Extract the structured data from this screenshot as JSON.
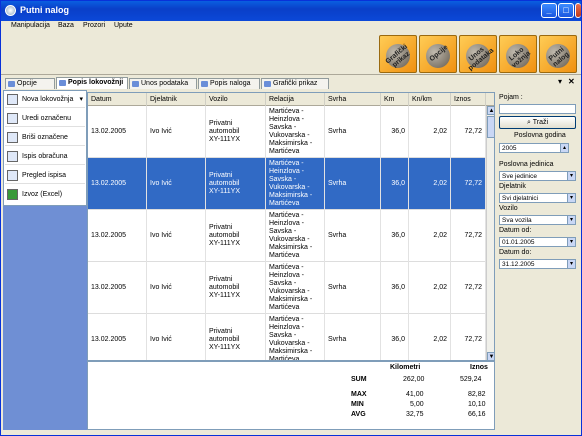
{
  "window": {
    "title": "Putni nalog"
  },
  "menu": [
    "Manipulacija",
    "Baza",
    "Prozori",
    "Upute"
  ],
  "toolbar": [
    "Grafički prikaz",
    "Opcije",
    "Unos podataka",
    "Loko vožnja",
    "Putni nalog"
  ],
  "tabs": [
    "Opcije",
    "Popis lokovožnji",
    "Unos podataka",
    "Popis naloga",
    "Grafički prikaz"
  ],
  "active_tab": 1,
  "sidebar": [
    "Nova lokovožnja",
    "Uredi označenu",
    "Briši označene",
    "Ispis obračuna",
    "Pregled ispisa",
    "Izvoz (Excel)"
  ],
  "columns": [
    "Datum",
    "Djelatnik",
    "Vozilo",
    "Relacija",
    "Svrha",
    "Km",
    "Kn/km",
    "Iznos"
  ],
  "rows": [
    {
      "datum": "13.02.2005",
      "djelatnik": "Ivo Ivić",
      "vozilo": "Privatni\nautomobil\nXY-111YX",
      "relacija": "Martićeva -\nHeinzlova -\nSavska -\nVukovarska -\nMaksimirska -\nMartićeva",
      "svrha": "Svrha",
      "km": "36,0",
      "knkm": "2,02",
      "iznos": "72,72",
      "selected": false
    },
    {
      "datum": "13.02.2005",
      "djelatnik": "Ivo Ivić",
      "vozilo": "Privatni\nautomobil\nXY-111YX",
      "relacija": "Martićeva -\nHeinzlova -\nSavska -\nVukovarska -\nMaksimirska -\nMartićeva",
      "svrha": "Svrha",
      "km": "36,0",
      "knkm": "2,02",
      "iznos": "72,72",
      "selected": true
    },
    {
      "datum": "13.02.2005",
      "djelatnik": "Ivo Ivić",
      "vozilo": "Privatni\nautomobil\nXY-111YX",
      "relacija": "Martićeva -\nHeinzlova -\nSavska -\nVukovarska -\nMaksimirska -\nMartićeva",
      "svrha": "Svrha",
      "km": "36,0",
      "knkm": "2,02",
      "iznos": "72,72",
      "selected": false
    },
    {
      "datum": "13.02.2005",
      "djelatnik": "Ivo Ivić",
      "vozilo": "Privatni\nautomobil\nXY-111YX",
      "relacija": "Martićeva -\nHeinzlova -\nSavska -\nVukovarska -\nMaksimirska -\nMartićeva",
      "svrha": "Svrha",
      "km": "36,0",
      "knkm": "2,02",
      "iznos": "72,72",
      "selected": false
    },
    {
      "datum": "13.02.2005",
      "djelatnik": "Ivo Ivić",
      "vozilo": "Privatni\nautomobil\nXY-111YX",
      "relacija": "Martićeva -\nHeinzlova -\nSavska -\nVukovarska -\nMaksimirska -\nMartićeva",
      "svrha": "Svrha",
      "km": "36,0",
      "knkm": "2,02",
      "iznos": "72,72",
      "selected": false
    }
  ],
  "stats": {
    "h_km": "Kilometri",
    "h_iznos": "Iznos",
    "sum_label": "SUM",
    "sum_km": "262,00",
    "sum_iznos": "529,24",
    "max_label": "MAX",
    "max_km": "41,00",
    "max_iznos": "82,82",
    "min_label": "MIN",
    "min_km": "5,00",
    "min_iznos": "10,10",
    "avg_label": "AVG",
    "avg_km": "32,75",
    "avg_iznos": "66,16"
  },
  "filter": {
    "pojam_label": "Pojam :",
    "pojam_value": "",
    "trazi": "Traži",
    "godina_label": "Poslovna godina",
    "godina_value": "2005",
    "jedinica_label": "Poslovna jedinica",
    "jedinica_value": "Sve jedinice",
    "djelatnik_label": "Djelatnik",
    "djelatnik_value": "Svi djelatnici",
    "vozilo_label": "Vozilo",
    "vozilo_value": "Sva vozila",
    "od_label": "Datum od:",
    "od_value": "01.01.2005",
    "do_label": "Datum do:",
    "do_value": "31.12.2005"
  }
}
